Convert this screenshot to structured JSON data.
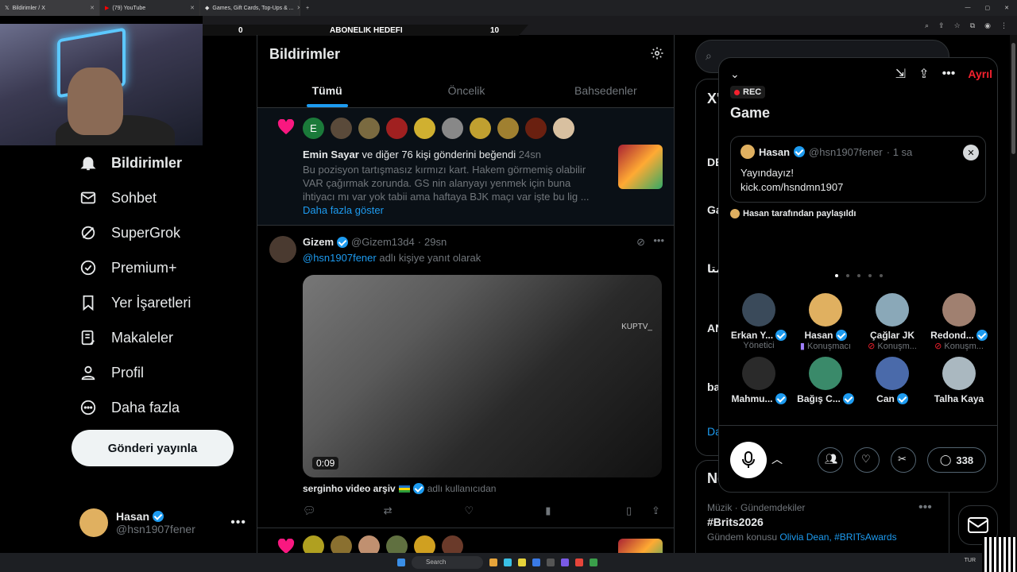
{
  "browser": {
    "tabs": [
      {
        "title": "Bildirimler / X"
      },
      {
        "title": "(79) YouTube"
      },
      {
        "title": "Games, Gift Cards, Top-Ups & ..."
      }
    ]
  },
  "banner": {
    "left": "0",
    "center": "ABONELIK HEDEFI",
    "right": "10"
  },
  "nav": {
    "items": [
      {
        "label": "Bildirimler",
        "icon": "bell-icon"
      },
      {
        "label": "Sohbet",
        "icon": "mail-icon"
      },
      {
        "label": "SuperGrok",
        "icon": "grok-icon"
      },
      {
        "label": "Premium+",
        "icon": "verified-icon"
      },
      {
        "label": "Yer İşaretleri",
        "icon": "bookmark-icon"
      },
      {
        "label": "Makaleler",
        "icon": "article-icon"
      },
      {
        "label": "Profil",
        "icon": "person-icon"
      },
      {
        "label": "Daha fazla",
        "icon": "more-circle-icon"
      }
    ],
    "post_button": "Gönderi yayınla",
    "account": {
      "name": "Hasan",
      "handle": "@hsn1907fener"
    }
  },
  "main": {
    "title": "Bildirimler",
    "tabs": [
      "Tümü",
      "Öncelik",
      "Bahsedenler"
    ],
    "like_notification": {
      "actor": "Emin Sayar",
      "text": "ve diğer 76 kişi gönderini beğendi",
      "time": "24sn",
      "body": "Bu pozisyon tartışmasız kırmızı kart. Hakem görmemiş olabilir VAR çağırmak zorunda. GS nin alanyayı yenmek için buna ihtiyacı mı var yok tabii ama haftaya BJK maçı var işte bu lig ...",
      "show_more": "Daha fazla göster",
      "first_avatar_letter": "E"
    },
    "tweet": {
      "name": "Gizem",
      "handle": "@Gizem13d4",
      "time": "29sn",
      "reply_to": "@hsn1907fener",
      "reply_suffix": "adlı kişiye yanıt olarak",
      "video_duration": "0:09",
      "watermark": "KUPTV_",
      "source_name": "serginho video arşiv",
      "source_suffix": "adlı kullanıcıdan"
    }
  },
  "right": {
    "card1": {
      "heading": "X'",
      "items": [
        {
          "label": "DE"
        },
        {
          "label": "Ga"
        },
        {
          "label": "متا"
        },
        {
          "label": "AN"
        },
        {
          "label": "ba"
        }
      ],
      "more": "Da"
    },
    "card2": {
      "heading": "Ne",
      "trend_meta": "Müzik · Gündemdekiler",
      "trend_name": "#Brits2026",
      "trend_info_prefix": "Gündem konusu",
      "trend_info_links": "Olivia Dean, #BRITsAwards"
    }
  },
  "space": {
    "leave": "Ayrıl",
    "rec": "REC",
    "title": "Game",
    "pinned": {
      "name": "Hasan",
      "handle": "@hsn1907fener",
      "time": "· 1 sa",
      "line1": "Yayındayız!",
      "line2": "kick.com/hsndmn1907"
    },
    "shared_by": "Hasan tarafından paylaşıldı",
    "people": [
      {
        "name": "Erkan Y...",
        "role": "Yönetici",
        "verified": true
      },
      {
        "name": "Hasan",
        "role": "Konuşmacı",
        "verified": true
      },
      {
        "name": "Çağlar JK",
        "role": "Konuşm...",
        "verified": false
      },
      {
        "name": "Redond...",
        "role": "Konuşm...",
        "verified": true
      },
      {
        "name": "Mahmu...",
        "role": "",
        "verified": true
      },
      {
        "name": "Bağış C...",
        "role": "",
        "verified": true
      },
      {
        "name": "Can",
        "role": "",
        "verified": true
      },
      {
        "name": "Talha Kaya",
        "role": "",
        "verified": false
      }
    ],
    "comment_count": "338"
  },
  "taskbar": {
    "search": "Search",
    "tray": "TUR"
  }
}
